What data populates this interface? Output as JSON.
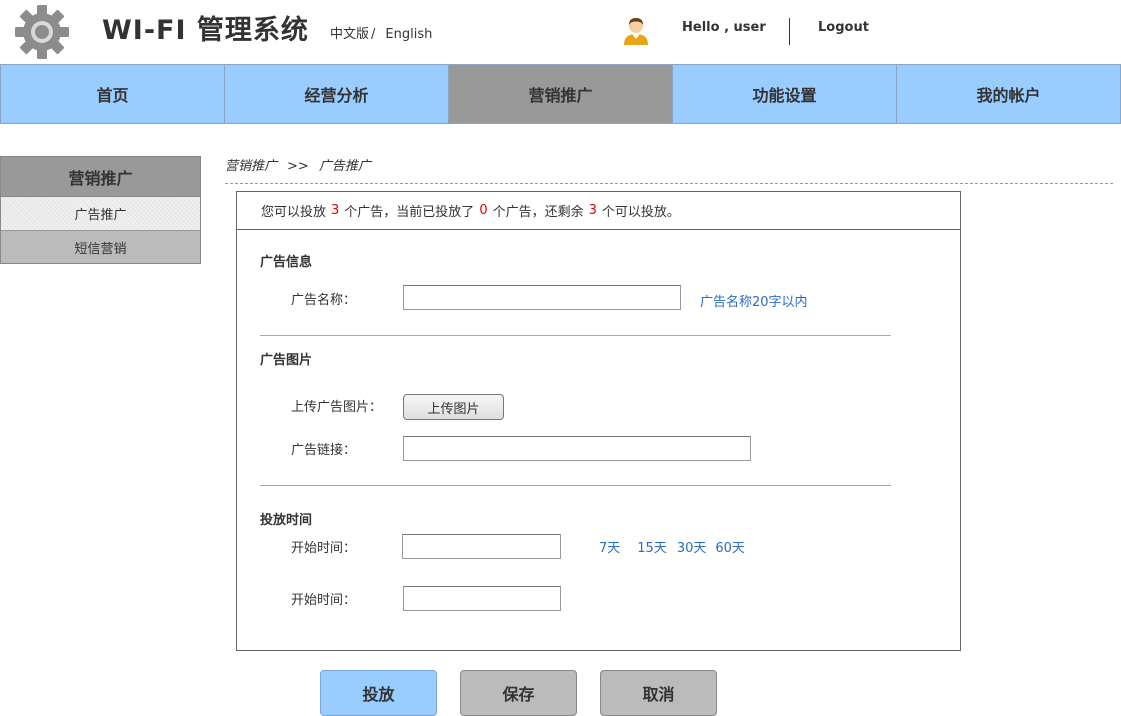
{
  "header": {
    "app_title": "WI-FI  管理系统",
    "lang_zh": "中文版",
    "lang_sep": "/",
    "lang_en": "English",
    "greeting": "Hello , user",
    "logout": "Logout",
    "icons": {
      "logo": "gear-icon",
      "user": "user-avatar-icon"
    }
  },
  "nav": {
    "items": [
      {
        "label": "首页",
        "active": false
      },
      {
        "label": "经营分析",
        "active": false
      },
      {
        "label": "营销推广",
        "active": true
      },
      {
        "label": "功能设置",
        "active": false
      },
      {
        "label": "我的帐户",
        "active": false
      }
    ]
  },
  "sidebar": {
    "title": "营销推广",
    "items": [
      {
        "label": "广告推广",
        "active": true
      },
      {
        "label": "短信营销",
        "active": false
      }
    ]
  },
  "breadcrumb": {
    "parent": "营销推广",
    "separator": ">>",
    "current": "广告推广"
  },
  "quota": {
    "text_1": "您可以投放",
    "total": "3",
    "text_2": "个广告，当前已投放了",
    "used": "0",
    "text_3": "个广告，还剩余",
    "remaining": "3",
    "text_4": "个可以投放。"
  },
  "ad_info": {
    "section_title": "广告信息",
    "name_label": "广告名称：",
    "name_value": "",
    "name_hint": "广告名称20字以内"
  },
  "ad_image": {
    "section_title": "广告图片",
    "upload_label": "上传广告图片：",
    "upload_button": "上传图片",
    "link_label": "广告链接：",
    "link_value": ""
  },
  "schedule": {
    "section_title": "投放时间",
    "start_label": "开始时间：",
    "start_value": "",
    "presets": [
      "7天",
      "15天",
      "30天",
      "60天"
    ],
    "second_label": "开始时间：",
    "second_value": ""
  },
  "actions": {
    "submit": "投放",
    "save": "保存",
    "cancel": "取消"
  },
  "colors": {
    "nav_bg": "#99ccff",
    "nav_active": "#999999",
    "hint_blue": "#2a6bc6",
    "count_red": "#e60000"
  }
}
